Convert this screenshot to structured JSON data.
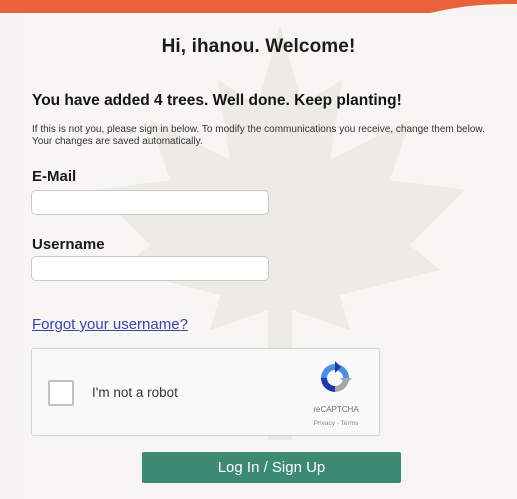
{
  "header": {
    "greeting": "Hi, ihanou. Welcome!"
  },
  "status": {
    "trees_message": "You have added 4 trees. Well done. Keep planting!",
    "info_text": "If this is not you, please sign in below. To modify the communications you receive, change them below. Your changes are saved automatically."
  },
  "form": {
    "email_label": "E-Mail",
    "email_value": "",
    "username_label": "Username",
    "username_value": "",
    "forgot_link": "Forgot your username?",
    "submit_label": "Log In / Sign Up"
  },
  "recaptcha": {
    "label": "I'm not a robot",
    "brand": "reCAPTCHA",
    "links": "Privacy - Terms",
    "checked": false
  },
  "colors": {
    "banner": "#e8623a",
    "button": "#3c8a74",
    "link": "#3a43a8"
  }
}
